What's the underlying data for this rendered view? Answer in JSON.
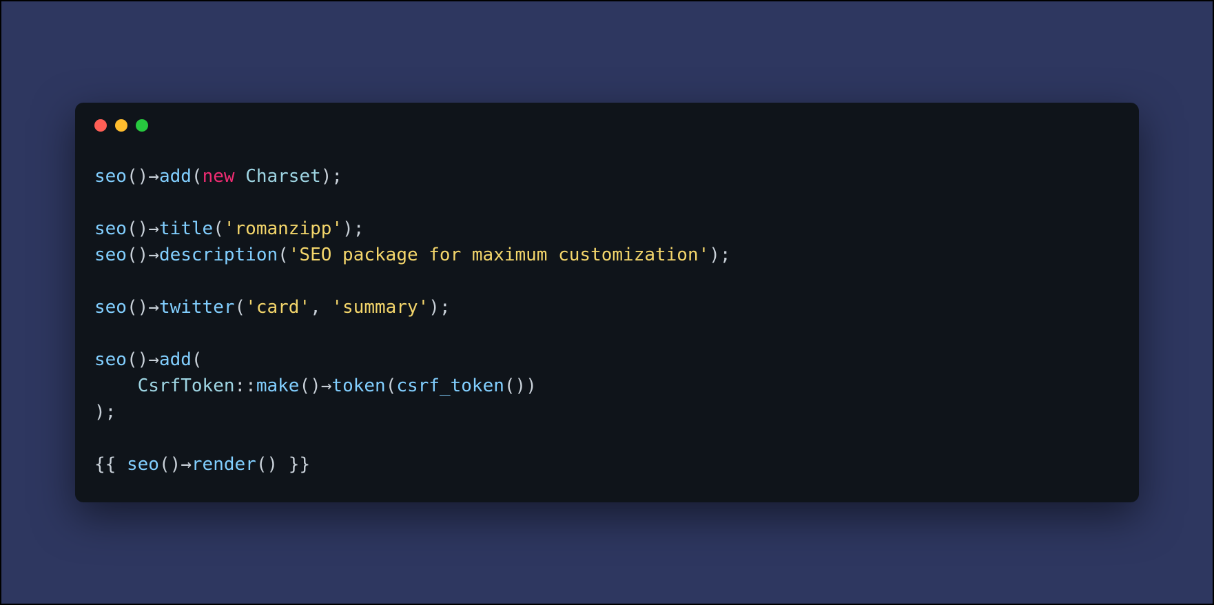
{
  "window": {
    "dots": {
      "red": "#ff5f56",
      "yellow": "#ffbd2e",
      "green": "#27c93f"
    }
  },
  "code": {
    "l1": {
      "fn1": "seo",
      "p1": "()→",
      "fn2": "add",
      "p2": "(",
      "kw": "new",
      "sp": " ",
      "cls": "Charset",
      "p3": ");"
    },
    "empty": "",
    "l3": {
      "fn1": "seo",
      "p1": "()→",
      "fn2": "title",
      "p2": "(",
      "str": "'romanzipp'",
      "p3": ");"
    },
    "l4": {
      "fn1": "seo",
      "p1": "()→",
      "fn2": "description",
      "p2": "(",
      "str": "'SEO package for maximum customization'",
      "p3": ");"
    },
    "l6": {
      "fn1": "seo",
      "p1": "()→",
      "fn2": "twitter",
      "p2": "(",
      "str1": "'card'",
      "sep": ", ",
      "str2": "'summary'",
      "p3": ");"
    },
    "l8": {
      "fn1": "seo",
      "p1": "()→",
      "fn2": "add",
      "p2": "("
    },
    "l9": {
      "indent": "    ",
      "ns": "CsrfToken",
      "dd": "::",
      "fn1": "make",
      "p1": "()→",
      "fn2": "token",
      "p2": "(",
      "fn3": "csrf_token",
      "p3": "())"
    },
    "l10": {
      "p": ");"
    },
    "l12": {
      "open": "{{ ",
      "fn1": "seo",
      "p1": "()→",
      "fn2": "render",
      "p2": "()",
      "close": " }}"
    }
  }
}
